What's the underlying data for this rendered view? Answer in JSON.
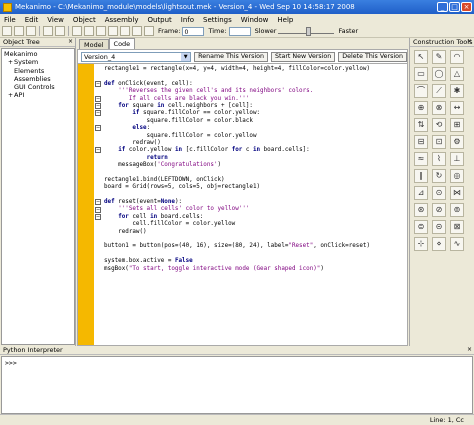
{
  "window": {
    "title": "Mekanimo  -  C:\\Mekanimo_module\\models\\lightsout.mek  -  Version_4  -  Wed Sep 10 14:58:17 2008"
  },
  "menu": [
    "File",
    "Edit",
    "View",
    "Object",
    "Assembly",
    "Output",
    "Info",
    "Settings",
    "Window",
    "Help"
  ],
  "toolbar": {
    "frame_label": "Frame:",
    "frame_value": "0",
    "time_label": "Time:",
    "time_value": "",
    "slower_label": "Slower",
    "faster_label": "Faster"
  },
  "object_tree": {
    "title": "Object Tree",
    "root": "Mekanimo",
    "items": [
      {
        "label": "System",
        "expander": "+"
      },
      {
        "label": "Elements",
        "expander": ""
      },
      {
        "label": "Assemblies",
        "expander": ""
      },
      {
        "label": "GUI Controls",
        "expander": ""
      },
      {
        "label": "API",
        "expander": "+"
      }
    ]
  },
  "tabs": [
    "Model",
    "Code"
  ],
  "version_bar": {
    "selected": "Version_4",
    "rename": "Rename This Version",
    "start_new": "Start New Version",
    "delete": "Delete This Version"
  },
  "code_lines": [
    "rectangle1 = rectangle(x=4, y=4, width=4, height=4, fillColor=color.yellow)",
    "",
    "def onClick(event, cell):",
    "    '''Reverses the given cell's and its neighbors' colors.",
    "       If all cells are black you win.'''",
    "    for square in cell.neighbors + [cell]:",
    "        if square.fillColor == color.yellow:",
    "            square.fillColor = color.black",
    "        else:",
    "            square.fillColor = color.yellow",
    "        redraw()",
    "    if color.yellow in [c.fillColor for c in board.cells]:",
    "            return",
    "    messageBox('Congratulations')",
    "",
    "rectangle1.bind(LEFTDOWN, onClick)",
    "board = Grid(rows=5, cols=5, obj=rectangle1)",
    "",
    "def reset(event=None):",
    "    '''Sets all cells' color to yellow'''",
    "    for cell in board.cells:",
    "        cell.fillColor = color.yellow",
    "    redraw()",
    "",
    "button1 = button(pos=(40, 16), size=(80, 24), label=\"Reset\", onClick=reset)",
    "",
    "system.box.active = False",
    "msgBox(\"To start, toggle interactive mode (Gear shaped icon)\")"
  ],
  "construction_tools": {
    "title": "Construction Tools"
  },
  "python": {
    "title": "Python Interpreter",
    "prompt": ">>>"
  },
  "status": {
    "position": "Line: 1, Cc"
  },
  "colors": {
    "gutter": "#f5b800",
    "title_bar": "#1f5fc8",
    "keyword": "#00007f",
    "string": "#7f007f"
  }
}
